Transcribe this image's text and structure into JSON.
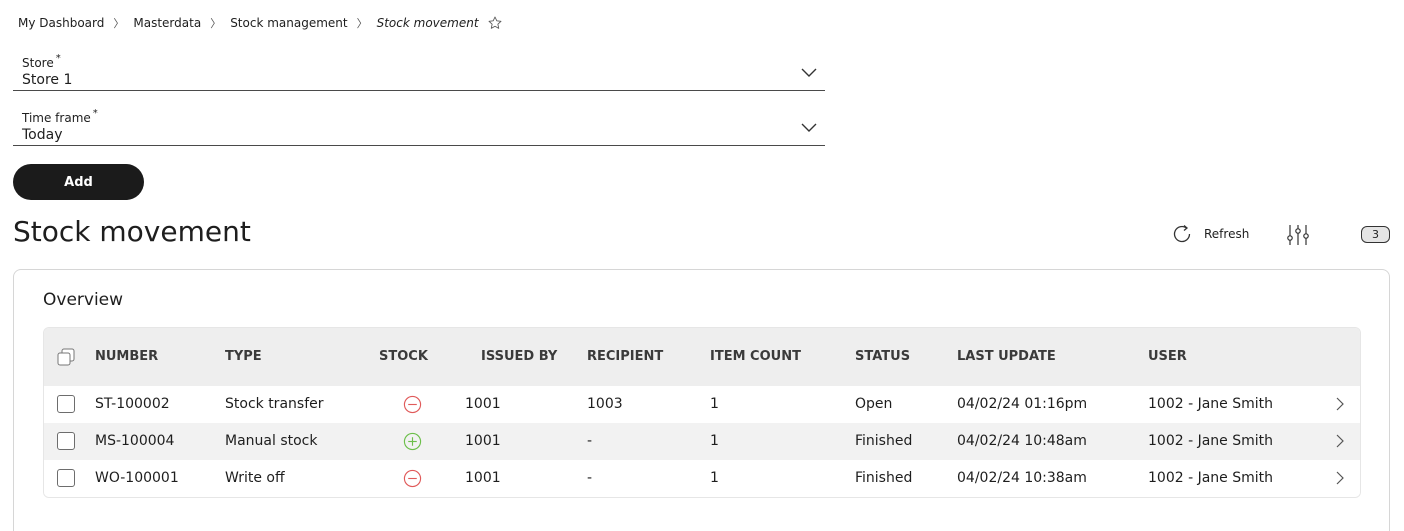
{
  "breadcrumb": {
    "items": [
      "My Dashboard",
      "Masterdata",
      "Stock management"
    ],
    "current": "Stock movement",
    "separator": "〉"
  },
  "form": {
    "store": {
      "label": "Store",
      "required": "*",
      "value": "Store 1"
    },
    "timeframe": {
      "label": "Time frame",
      "required": "*",
      "value": "Today"
    },
    "add_label": "Add"
  },
  "page": {
    "title": "Stock movement",
    "refresh_label": "Refresh",
    "filter_count": "3"
  },
  "overview": {
    "title": "Overview",
    "columns": [
      "NUMBER",
      "TYPE",
      "STOCK",
      "ISSUED BY",
      "RECIPIENT",
      "ITEM COUNT",
      "STATUS",
      "LAST UPDATE",
      "USER"
    ],
    "rows": [
      {
        "number": "ST-100002",
        "type": "Stock transfer",
        "stock": "minus",
        "issued_by": "1001",
        "recipient": "1003",
        "item_count": "1",
        "status": "Open",
        "last_update": "04/02/24 01:16pm",
        "user": "1002 - Jane Smith"
      },
      {
        "number": "MS-100004",
        "type": "Manual stock",
        "stock": "plus",
        "issued_by": "1001",
        "recipient": "-",
        "item_count": "1",
        "status": "Finished",
        "last_update": "04/02/24 10:48am",
        "user": "1002 - Jane Smith"
      },
      {
        "number": "WO-100001",
        "type": "Write off",
        "stock": "minus",
        "issued_by": "1001",
        "recipient": "-",
        "item_count": "1",
        "status": "Finished",
        "last_update": "04/02/24 10:38am",
        "user": "1002 - Jane Smith"
      }
    ]
  },
  "colors": {
    "minus": "#e05a5a",
    "plus": "#6cbf4a",
    "button": "#1b1b1b"
  },
  "icons": {
    "favorite": "star-icon",
    "dropdown": "chevron-down-icon",
    "refresh": "refresh-icon",
    "filter": "sliders-icon",
    "select_all": "copy-icon",
    "row_open": "chevron-right-icon"
  }
}
